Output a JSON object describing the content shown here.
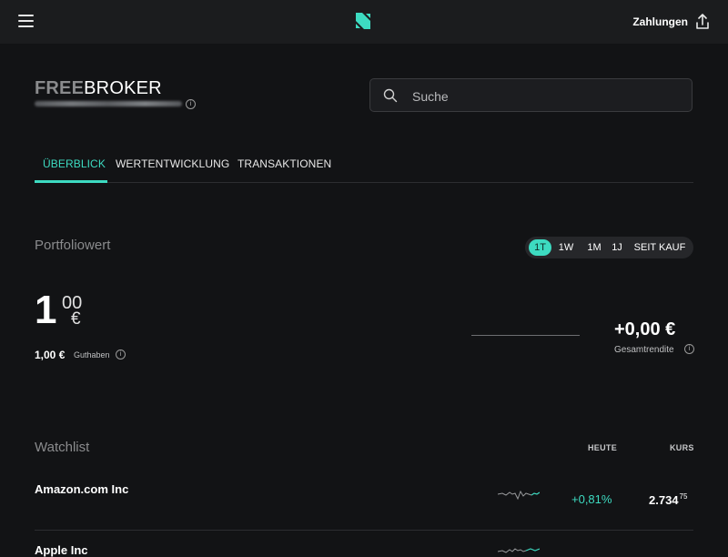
{
  "header": {
    "payments_label": "Zahlungen"
  },
  "icons": {
    "menu": "hamburger-icon",
    "logo": "s-logo-icon",
    "upload": "upload-icon",
    "search": "search-icon",
    "info": "info-icon"
  },
  "brand": {
    "free": "FREE",
    "broker": "BROKER"
  },
  "search": {
    "placeholder": "Suche"
  },
  "tabs": [
    {
      "label": "ÜBERBLICK",
      "active": true
    },
    {
      "label": "WERTENTWICKLUNG",
      "active": false
    },
    {
      "label": "TRANSAKTIONEN",
      "active": false
    }
  ],
  "portfolio": {
    "title": "Portfoliowert",
    "ranges": [
      {
        "label": "1T",
        "active": true
      },
      {
        "label": "1W",
        "active": false
      },
      {
        "label": "1M",
        "active": false
      },
      {
        "label": "1J",
        "active": false
      },
      {
        "label": "SEIT KAUF",
        "active": false
      }
    ],
    "value_int": "1",
    "value_dec": "00",
    "value_currency": "€",
    "balance_value": "1,00 €",
    "balance_label": "Guthaben",
    "return_value": "+0,00 €",
    "return_label": "Gesamtrendite"
  },
  "watchlist": {
    "title": "Watchlist",
    "col_today": "HEUTE",
    "col_price": "KURS",
    "rows": [
      {
        "name": "Amazon.com Inc",
        "change": "+0,81%",
        "price_main": "2.734",
        "price_dec": "75"
      },
      {
        "name": "Apple Inc",
        "change": "",
        "price_main": "",
        "price_dec": ""
      }
    ]
  },
  "colors": {
    "accent": "#3ddbc1",
    "background": "#121315",
    "topbar": "#1b1c1e"
  }
}
